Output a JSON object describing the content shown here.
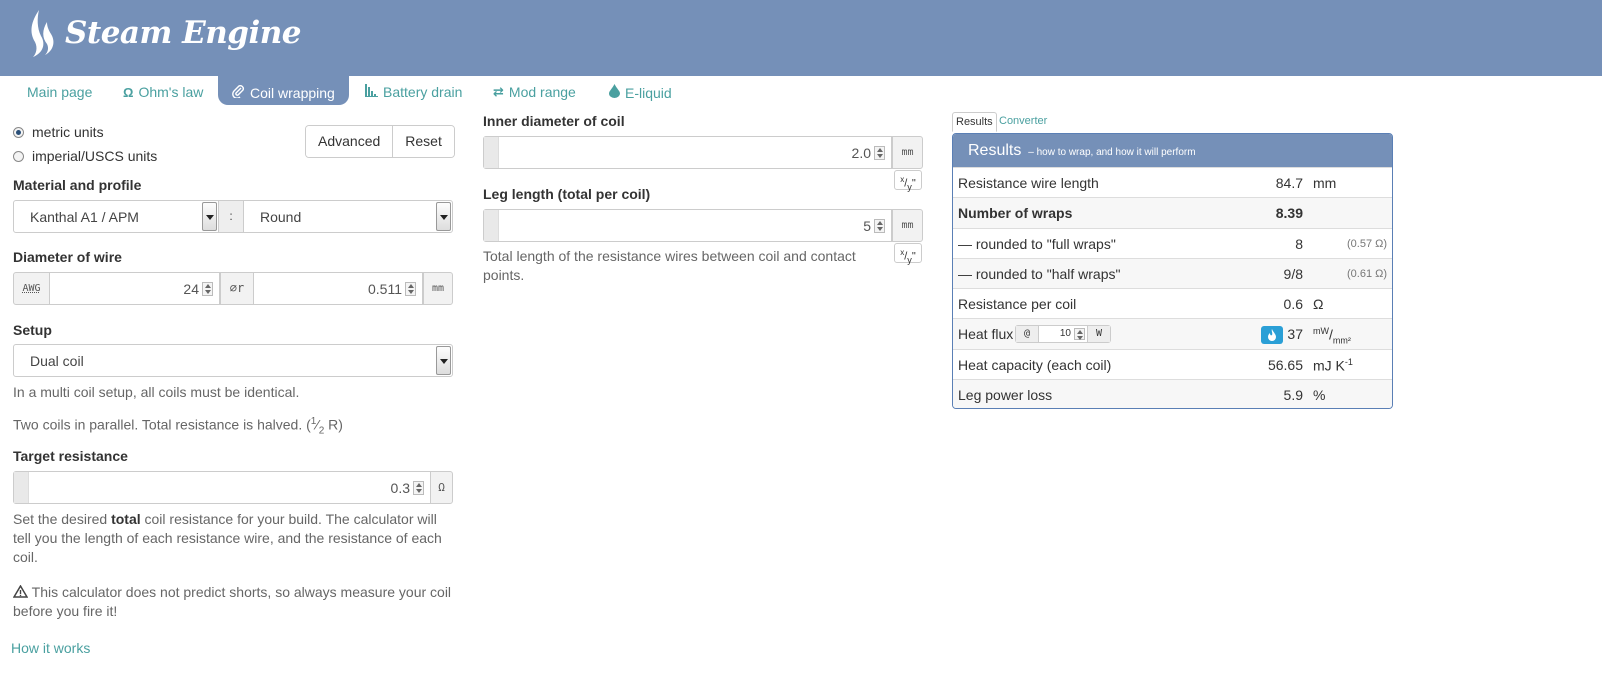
{
  "app": {
    "title": "Steam Engine"
  },
  "nav": [
    {
      "label": "Main page",
      "icon": ""
    },
    {
      "label": "Ohm's law",
      "icon": "omega-icon"
    },
    {
      "label": "Coil wrapping",
      "icon": "paperclip-icon"
    },
    {
      "label": "Battery drain",
      "icon": "bar-chart-icon"
    },
    {
      "label": "Mod range",
      "icon": "arrows-icon"
    },
    {
      "label": "E-liquid",
      "icon": "droplet-icon"
    }
  ],
  "units": {
    "metric": "metric units",
    "imperial": "imperial/USCS units",
    "selected": "metric"
  },
  "buttons": {
    "advanced": "Advanced",
    "reset": "Reset"
  },
  "material": {
    "label": "Material and profile",
    "value": "Kanthal A1 / APM",
    "separator": ":",
    "profile": "Round"
  },
  "wire": {
    "label": "Diameter of wire",
    "awg_label": "AWG",
    "awg": "24",
    "dia_symbol": "⌀r",
    "dia": "0.511",
    "unit": "mm"
  },
  "setup": {
    "label": "Setup",
    "value": "Dual coil",
    "help1": "In a multi coil setup, all coils must be identical.",
    "help2_a": "Two coils in parallel. Total resistance is halved. (",
    "help2_frac_n": "1",
    "help2_frac_d": "2",
    "help2_b": " R)"
  },
  "target": {
    "label": "Target resistance",
    "value": "0.3",
    "unit": "Ω",
    "help_a": "Set the desired ",
    "help_bold": "total",
    "help_b": " coil resistance for your build. The calculator will tell you the length of each resistance wire, and the resistance of each coil."
  },
  "warning": {
    "text": "This calculator does not predict shorts, so always measure your coil before you fire it!"
  },
  "how_it_works": "How it works",
  "inner": {
    "label": "Inner diameter of coil",
    "value": "2.0",
    "unit": "mm",
    "xy": "x/y\""
  },
  "leg": {
    "label": "Leg length (total per coil)",
    "value": "5",
    "unit": "mm",
    "help": "Total length of the resistance wires between coil and contact points."
  },
  "results": {
    "tabs": [
      "Results",
      "Converter"
    ],
    "title": "Results",
    "subtitle": "– how to wrap, and how it will perform",
    "rows": [
      {
        "label": "Resistance wire length",
        "value": "84.7",
        "unit": "mm"
      },
      {
        "label": "Number of wraps",
        "value": "8.39"
      },
      {
        "label": "— rounded to \"full wraps\"",
        "value": "8",
        "extra": "(0.57 Ω)"
      },
      {
        "label": "— rounded to \"half wraps\"",
        "value": "9/8",
        "extra": "(0.61 Ω)"
      },
      {
        "label": "Resistance per coil",
        "value": "0.6",
        "unit": "Ω"
      },
      {
        "label": "Heat flux",
        "at": "@",
        "watts": "10",
        "w": "W",
        "value": "37",
        "unit_num": "mW",
        "unit_den": "mm²"
      },
      {
        "label": "Heat capacity (each coil)",
        "value": "56.65",
        "unit": "mJ K",
        "unit_sup": "-1"
      },
      {
        "label": "Leg power loss",
        "value": "5.9",
        "unit": "%"
      }
    ]
  }
}
